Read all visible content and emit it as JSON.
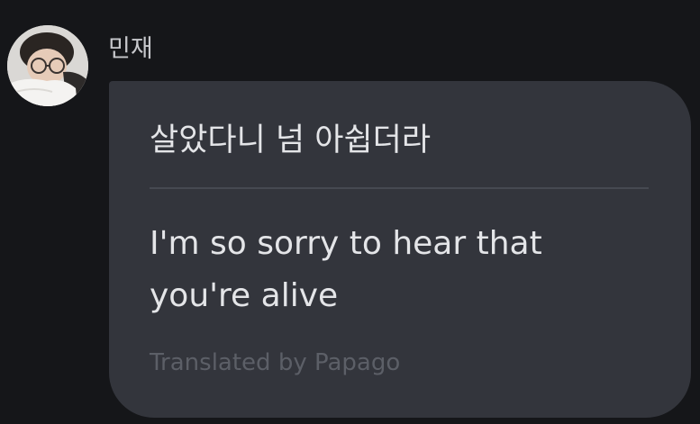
{
  "message": {
    "sender": "민재",
    "avatar_icon": "user-avatar-photo",
    "original_text": "살았다니 넘 아쉽더라",
    "translated_text": "I'm so sorry to hear that you're alive",
    "attribution": "Translated by Papago"
  },
  "colors": {
    "background": "#151619",
    "bubble": "#33353c",
    "text": "#e4e5e8",
    "muted": "#5c5f67"
  }
}
